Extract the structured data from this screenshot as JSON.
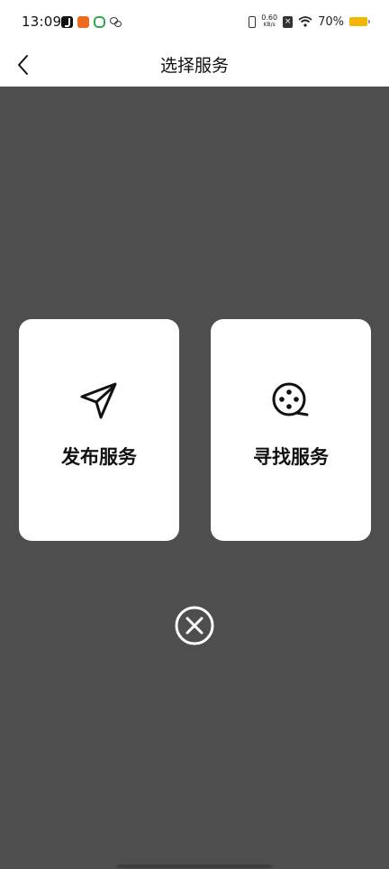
{
  "status_bar": {
    "time": "13:09",
    "notifications": [
      "tiktok-icon",
      "orange-app-icon",
      "green-app-icon",
      "wechat-icon"
    ],
    "net_speed_value": "0.60",
    "net_speed_unit": "KB/s",
    "battery_percent": "70%",
    "battery_color": "#f2b705"
  },
  "nav": {
    "back_icon": "chevron-left-icon",
    "title": "选择服务"
  },
  "overlay_color": "#4e4e4e",
  "cards": [
    {
      "label": "发布服务",
      "icon": "paper-plane-icon"
    },
    {
      "label": "寻找服务",
      "icon": "film-reel-search-icon"
    }
  ],
  "close_icon": "close-circle-icon"
}
